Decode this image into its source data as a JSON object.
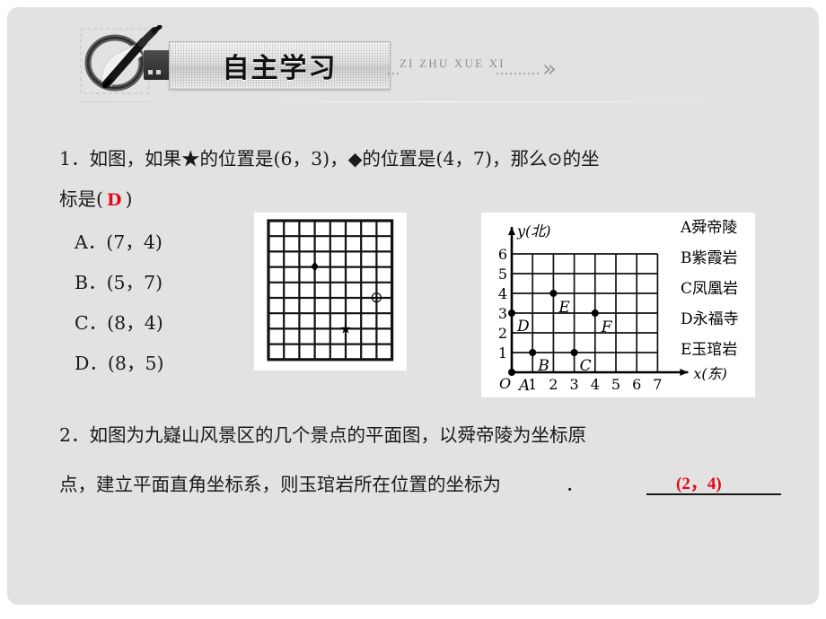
{
  "header": {
    "title": "自主学习",
    "pinyin": "ZI ZHU XUE XI",
    "chevron": "»",
    "icon_name": "pen-writing-icon"
  },
  "questions": [
    {
      "number": "1．",
      "stem_part1": "如图，如果★的位置是(6，3)，◆的位置是(4，7)，那么⊙的坐",
      "stem_part2_prefix": "标是(",
      "answer": "D",
      "stem_part2_suffix": ")",
      "options": [
        "A．(7，4)",
        " B．(5，7)",
        "C．(8，4)",
        "D．(8，5)"
      ]
    },
    {
      "number": "2．",
      "stem_part1": "如图为九嶷山风景区的几个景点的平面图，以舜帝陵为坐标原",
      "stem_part2": "点，建立平面直角坐标系，则玉琯岩所在位置的坐标为",
      "answer": "(2，4)",
      "tail": "．"
    }
  ],
  "figure_grid": {
    "cols": 8,
    "rows": 9,
    "symbols": [
      {
        "glyph": "♦",
        "name": "diamond-marker",
        "col": 3,
        "row": 3
      },
      {
        "glyph": "★",
        "name": "star-marker",
        "col": 5,
        "row": 7
      },
      {
        "glyph": "⊙",
        "name": "circle-dot-marker",
        "col": 7,
        "row": 5
      }
    ]
  },
  "chart_data": {
    "type": "scatter",
    "title": "",
    "xlabel": "x(东)",
    "ylabel": "y(北)",
    "origin_label": "O",
    "xlim": [
      0,
      7
    ],
    "ylim": [
      0,
      6
    ],
    "xticks": [
      "1",
      "2",
      "3",
      "4",
      "5",
      "6",
      "7"
    ],
    "yticks": [
      "1",
      "2",
      "3",
      "4",
      "5",
      "6"
    ],
    "grid": true,
    "points": [
      {
        "label": "A",
        "x": 0,
        "y": 0
      },
      {
        "label": "B",
        "x": 1,
        "y": 1
      },
      {
        "label": "C",
        "x": 3,
        "y": 1
      },
      {
        "label": "D",
        "x": 0,
        "y": 3
      },
      {
        "label": "E",
        "x": 2,
        "y": 4
      },
      {
        "label": "F",
        "x": 4,
        "y": 3
      }
    ],
    "legend_position": "right",
    "legend": [
      "A舜帝陵",
      "B紫霞岩",
      "C凤凰岩",
      "D永福寺",
      "E玉琯岩"
    ]
  },
  "colors": {
    "background": "#e2e2e2",
    "panel": "#ffffff",
    "text": "#1a1a1a",
    "accent_red": "#e2081a",
    "ink": "#000000"
  }
}
